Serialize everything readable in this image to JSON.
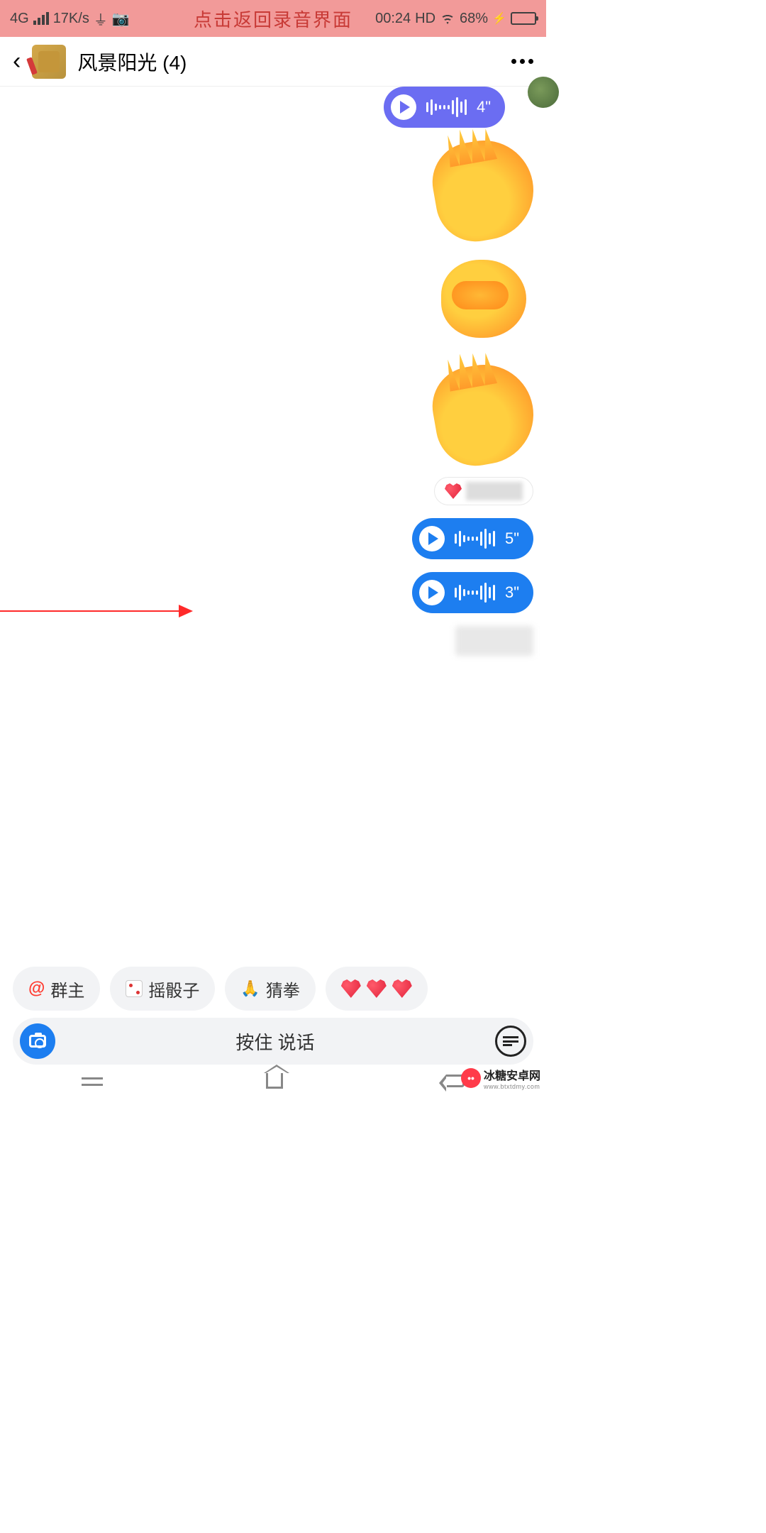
{
  "status": {
    "network": "4G",
    "speed": "17K/s",
    "overlay": "点击返回录音界面",
    "time": "00:24",
    "hd": "HD",
    "battery_pct": "68%"
  },
  "header": {
    "title": "风景阳光",
    "count": "(4)"
  },
  "messages": {
    "voice1_dur": "4\"",
    "voice2_dur": "5\"",
    "voice3_dur": "3\""
  },
  "suggestions": {
    "at_label": "群主",
    "dice_label": "摇骰子",
    "rps_label": "猜拳"
  },
  "input": {
    "hold_label": "按住 说话"
  },
  "watermark": {
    "text": "冰糖安卓网",
    "sub": "www.btxtdmy.com"
  }
}
